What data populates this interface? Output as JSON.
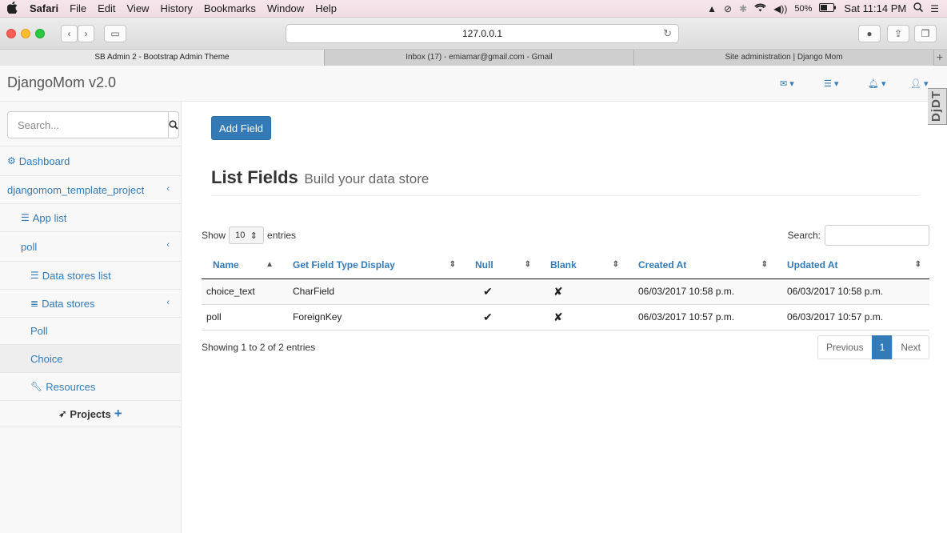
{
  "menubar": {
    "app": "Safari",
    "items": [
      "File",
      "Edit",
      "View",
      "History",
      "Bookmarks",
      "Window",
      "Help"
    ],
    "battery": "50%",
    "clock": "Sat 11:14 PM"
  },
  "browser": {
    "url": "127.0.0.1",
    "tabs": [
      {
        "title": "SB Admin 2 - Bootstrap Admin Theme",
        "active": true
      },
      {
        "title": "Inbox (17) - emiamar@gmail.com - Gmail",
        "active": false
      },
      {
        "title": "Site administration | Django Mom",
        "active": false
      }
    ],
    "new_tab": "+"
  },
  "navbar": {
    "brand": "DjangoMom v2.0",
    "debug_toolbar": "DjDT"
  },
  "sidebar": {
    "search_placeholder": "Search...",
    "dashboard": "Dashboard",
    "project": "djangomom_template_project",
    "app_list": "App list",
    "poll": "poll",
    "data_stores_list": "Data stores list",
    "data_stores": "Data stores",
    "poll_model": "Poll",
    "choice_model": "Choice",
    "resources": "Resources",
    "projects": "Projects"
  },
  "main": {
    "add_button": "Add Field",
    "title": "List Fields",
    "subtitle": "Build your data store",
    "show_label": "Show",
    "entries_value": "10",
    "entries_label": "entries",
    "search_label": "Search:",
    "columns": [
      "Name",
      "Get Field Type Display",
      "Null",
      "Blank",
      "Created At",
      "Updated At"
    ],
    "rows": [
      {
        "name": "choice_text",
        "type": "CharField",
        "null": "✔",
        "blank": "✘",
        "created": "06/03/2017 10:58 p.m.",
        "updated": "06/03/2017 10:58 p.m."
      },
      {
        "name": "poll",
        "type": "ForeignKey",
        "null": "✔",
        "blank": "✘",
        "created": "06/03/2017 10:57 p.m.",
        "updated": "06/03/2017 10:57 p.m."
      }
    ],
    "info": "Showing 1 to 2 of 2 entries",
    "pager": {
      "previous": "Previous",
      "current": "1",
      "next": "Next"
    }
  },
  "colors": {
    "primary": "#337ab7",
    "sidebar_bg": "#f8f8f8",
    "menubar_bg": "#f6e6ec"
  }
}
